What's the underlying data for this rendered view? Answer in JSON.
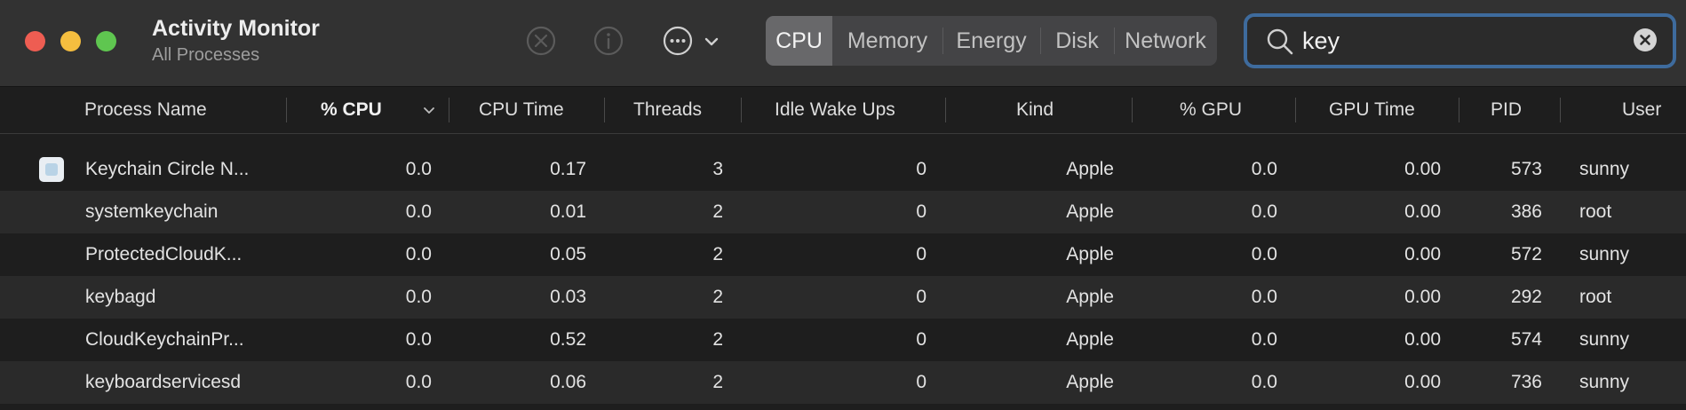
{
  "window": {
    "title": "Activity Monitor",
    "subtitle": "All Processes"
  },
  "toolbar": {
    "stop_icon": "stop-process-icon",
    "info_icon": "info-icon",
    "more_icon": "more-options-icon",
    "chevron_icon": "chevron-down-icon"
  },
  "tabs": [
    {
      "label": "CPU",
      "active": true
    },
    {
      "label": "Memory",
      "active": false
    },
    {
      "label": "Energy",
      "active": false
    },
    {
      "label": "Disk",
      "active": false
    },
    {
      "label": "Network",
      "active": false
    }
  ],
  "search": {
    "value": "key",
    "icon": "search-icon",
    "clear_icon": "clear-icon"
  },
  "columns": {
    "process_name": "Process Name",
    "cpu_percent": "% CPU",
    "cpu_time": "CPU Time",
    "threads": "Threads",
    "idle_wake_ups": "Idle Wake Ups",
    "kind": "Kind",
    "gpu_percent": "% GPU",
    "gpu_time": "GPU Time",
    "pid": "PID",
    "user": "User"
  },
  "sort": {
    "column": "% CPU",
    "direction": "descending"
  },
  "processes": [
    {
      "name": "Keychain Circle N...",
      "cpu": "0.0",
      "cpu_time": "0.17",
      "threads": "3",
      "idle_wake_ups": "0",
      "kind": "Apple",
      "gpu": "0.0",
      "gpu_time": "0.00",
      "pid": "573",
      "user": "sunny"
    },
    {
      "name": "systemkeychain",
      "cpu": "0.0",
      "cpu_time": "0.01",
      "threads": "2",
      "idle_wake_ups": "0",
      "kind": "Apple",
      "gpu": "0.0",
      "gpu_time": "0.00",
      "pid": "386",
      "user": "root"
    },
    {
      "name": "ProtectedCloudK...",
      "cpu": "0.0",
      "cpu_time": "0.05",
      "threads": "2",
      "idle_wake_ups": "0",
      "kind": "Apple",
      "gpu": "0.0",
      "gpu_time": "0.00",
      "pid": "572",
      "user": "sunny"
    },
    {
      "name": "keybagd",
      "cpu": "0.0",
      "cpu_time": "0.03",
      "threads": "2",
      "idle_wake_ups": "0",
      "kind": "Apple",
      "gpu": "0.0",
      "gpu_time": "0.00",
      "pid": "292",
      "user": "root"
    },
    {
      "name": "CloudKeychainPr...",
      "cpu": "0.0",
      "cpu_time": "0.52",
      "threads": "2",
      "idle_wake_ups": "0",
      "kind": "Apple",
      "gpu": "0.0",
      "gpu_time": "0.00",
      "pid": "574",
      "user": "sunny"
    },
    {
      "name": "keyboardservicesd",
      "cpu": "0.0",
      "cpu_time": "0.06",
      "threads": "2",
      "idle_wake_ups": "0",
      "kind": "Apple",
      "gpu": "0.0",
      "gpu_time": "0.00",
      "pid": "736",
      "user": "sunny"
    }
  ],
  "colors": {
    "accent": "#3e6b9d",
    "window_bg": "#1e1e1e",
    "toolbar_bg": "#323232",
    "traffic_close": "#ee5d52",
    "traffic_minimize": "#f5be3f",
    "traffic_maximize": "#5fc650"
  }
}
